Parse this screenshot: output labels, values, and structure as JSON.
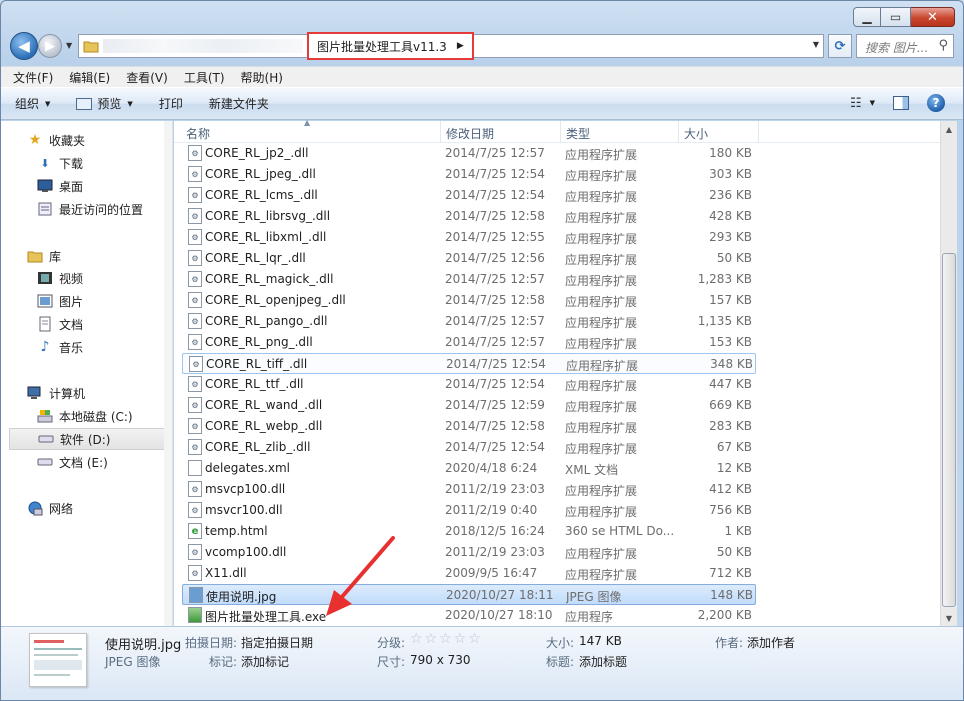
{
  "window": {
    "caption": {
      "min": "▁",
      "max": "▭",
      "close": "✕"
    }
  },
  "nav": {
    "back": "◀",
    "forward": "▶",
    "address_crumb": "图片批量处理工具v11.3",
    "search_placeholder": "搜索 图片..."
  },
  "menu": [
    "文件(F)",
    "编辑(E)",
    "查看(V)",
    "工具(T)",
    "帮助(H)"
  ],
  "toolbar": {
    "organize": "组织",
    "preview": "预览",
    "print": "打印",
    "new_folder": "新建文件夹"
  },
  "sidebar": {
    "items": [
      {
        "label": "收藏夹",
        "icon": "star-icon"
      },
      {
        "label": "下载",
        "icon": "download-folder-icon"
      },
      {
        "label": "桌面",
        "icon": "desktop-icon"
      },
      {
        "label": "最近访问的位置",
        "icon": "recent-places-icon"
      },
      {
        "label": "库",
        "icon": "library-icon"
      },
      {
        "label": "视频",
        "icon": "video-icon"
      },
      {
        "label": "图片",
        "icon": "pictures-icon"
      },
      {
        "label": "文档",
        "icon": "documents-icon"
      },
      {
        "label": "音乐",
        "icon": "music-icon"
      },
      {
        "label": "计算机",
        "icon": "computer-icon"
      },
      {
        "label": "本地磁盘 (C:)",
        "icon": "system-drive-icon"
      },
      {
        "label": "软件 (D:)",
        "icon": "drive-icon"
      },
      {
        "label": "文档 (E:)",
        "icon": "drive-icon"
      },
      {
        "label": "网络",
        "icon": "network-icon"
      }
    ]
  },
  "columns": {
    "name": "名称",
    "date": "修改日期",
    "type": "类型",
    "size": "大小"
  },
  "files": [
    {
      "name": "CORE_RL_jp2_.dll",
      "date": "2014/7/25 12:57",
      "type": "应用程序扩展",
      "size": "180 KB"
    },
    {
      "name": "CORE_RL_jpeg_.dll",
      "date": "2014/7/25 12:54",
      "type": "应用程序扩展",
      "size": "303 KB"
    },
    {
      "name": "CORE_RL_lcms_.dll",
      "date": "2014/7/25 12:54",
      "type": "应用程序扩展",
      "size": "236 KB"
    },
    {
      "name": "CORE_RL_librsvg_.dll",
      "date": "2014/7/25 12:58",
      "type": "应用程序扩展",
      "size": "428 KB"
    },
    {
      "name": "CORE_RL_libxml_.dll",
      "date": "2014/7/25 12:55",
      "type": "应用程序扩展",
      "size": "293 KB"
    },
    {
      "name": "CORE_RL_lqr_.dll",
      "date": "2014/7/25 12:56",
      "type": "应用程序扩展",
      "size": "50 KB"
    },
    {
      "name": "CORE_RL_magick_.dll",
      "date": "2014/7/25 12:57",
      "type": "应用程序扩展",
      "size": "1,283 KB"
    },
    {
      "name": "CORE_RL_openjpeg_.dll",
      "date": "2014/7/25 12:58",
      "type": "应用程序扩展",
      "size": "157 KB"
    },
    {
      "name": "CORE_RL_pango_.dll",
      "date": "2014/7/25 12:57",
      "type": "应用程序扩展",
      "size": "1,135 KB"
    },
    {
      "name": "CORE_RL_png_.dll",
      "date": "2014/7/25 12:57",
      "type": "应用程序扩展",
      "size": "153 KB"
    },
    {
      "name": "CORE_RL_tiff_.dll",
      "date": "2014/7/25 12:54",
      "type": "应用程序扩展",
      "size": "348 KB"
    },
    {
      "name": "CORE_RL_ttf_.dll",
      "date": "2014/7/25 12:54",
      "type": "应用程序扩展",
      "size": "447 KB"
    },
    {
      "name": "CORE_RL_wand_.dll",
      "date": "2014/7/25 12:59",
      "type": "应用程序扩展",
      "size": "669 KB"
    },
    {
      "name": "CORE_RL_webp_.dll",
      "date": "2014/7/25 12:58",
      "type": "应用程序扩展",
      "size": "283 KB"
    },
    {
      "name": "CORE_RL_zlib_.dll",
      "date": "2014/7/25 12:54",
      "type": "应用程序扩展",
      "size": "67 KB"
    },
    {
      "name": "delegates.xml",
      "date": "2020/4/18 6:24",
      "type": "XML 文档",
      "size": "12 KB"
    },
    {
      "name": "msvcp100.dll",
      "date": "2011/2/19 23:03",
      "type": "应用程序扩展",
      "size": "412 KB"
    },
    {
      "name": "msvcr100.dll",
      "date": "2011/2/19 0:40",
      "type": "应用程序扩展",
      "size": "756 KB"
    },
    {
      "name": "temp.html",
      "date": "2018/12/5 16:24",
      "type": "360 se HTML Do...",
      "size": "1 KB"
    },
    {
      "name": "vcomp100.dll",
      "date": "2011/2/19 23:03",
      "type": "应用程序扩展",
      "size": "50 KB"
    },
    {
      "name": "X11.dll",
      "date": "2009/9/5 16:47",
      "type": "应用程序扩展",
      "size": "712 KB"
    },
    {
      "name": "使用说明.jpg",
      "date": "2020/10/27 18:11",
      "type": "JPEG 图像",
      "size": "148 KB"
    },
    {
      "name": "图片批量处理工具.exe",
      "date": "2020/10/27 18:10",
      "type": "应用程序",
      "size": "2,200 KB"
    }
  ],
  "details": {
    "filename": "使用说明.jpg",
    "filetype": "JPEG 图像",
    "shot_date_label": "拍摄日期:",
    "shot_date_value": "指定拍摄日期",
    "tags_label": "标记:",
    "tags_value": "添加标记",
    "rating_label": "分级:",
    "rating_stars": "☆☆☆☆☆",
    "dimensions_label": "尺寸:",
    "dimensions_value": "790 x 730",
    "size_label": "大小:",
    "size_value": "147 KB",
    "title_label": "标题:",
    "title_value": "添加标题",
    "author_label": "作者:",
    "author_value": "添加作者"
  },
  "colors": {
    "highlight_box": "#e43a3a",
    "arrow": "#e8312f",
    "selection": "#c1dcfb"
  }
}
